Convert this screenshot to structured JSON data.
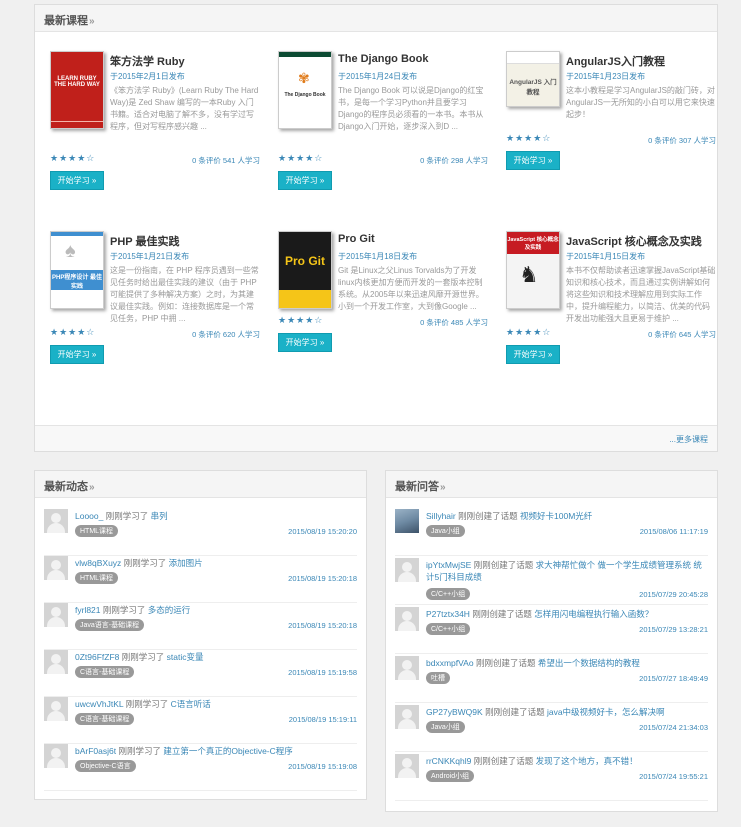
{
  "latest_courses": {
    "heading": "最新课程",
    "more": "...更多课程",
    "courses": [
      {
        "title": "笨方法学 Ruby",
        "date": "于2015年2月1日发布",
        "desc": "《笨方法学 Ruby》(Learn Ruby The Hard Way)是 Zed Shaw 编写的一本Ruby 入门书籍。适合对电脑了解不多，没有学过写程序，但对写程序感兴趣 ...",
        "stars": "★★★★☆",
        "meta": "0 条评价 541 人学习",
        "button": "开始学习 »",
        "cover_text": "LEARN RUBY THE HARD WAY",
        "cover_color": "#c0201b"
      },
      {
        "title": "The Django Book",
        "date": "于2015年1月24日发布",
        "desc": "The Django Book 可以说是Django的红宝书，是每一个学习Python并且要学习Django的程序员必须看的一本书。本书从Django入门开始，逐步深入到D ...",
        "stars": "★★★★☆",
        "meta": "0 条评价 298 人学习",
        "button": "开始学习 »",
        "cover_text": "The Django Book",
        "cover_color": "#ffffff"
      },
      {
        "title": "AngularJS入门教程",
        "date": "于2015年1月23日发布",
        "desc": "这本小教程是学习AngularJS的敲门砖，对AngularJS一无所知的小白可以用它来快速起步！",
        "stars": "★★★★☆",
        "meta": "0 条评价 307 人学习",
        "button": "开始学习 »",
        "cover_text": "AngularJS 入门教程",
        "cover_color": "#f3f1e6"
      },
      {
        "title": "PHP 最佳实践",
        "date": "于2015年1月21日发布",
        "desc": "这是一份指南，在 PHP 程序员遇到一些常见任务时给出最佳实践的建议（由于 PHP 可能提供了多种解决方案）之时，为其建议最佳实践。例如：连接数据库是一个常见任务，PHP 中拥 ...",
        "stars": "★★★★☆",
        "meta": "0 条评价 620 人学习",
        "button": "开始学习 »",
        "cover_text": "PHP程序设计 最佳实践",
        "cover_color": "#3f8fd0"
      },
      {
        "title": "Pro Git",
        "date": "于2015年1月18日发布",
        "desc": "Git 是Linux之父Linus Torvalds为了开发linux内核更加方便而开发的一套版本控制系统。从2005年以来迅速风靡开源世界。小到一个开发工作室，大到像Google ...",
        "stars": "★★★★☆",
        "meta": "0 条评价 485 人学习",
        "button": "开始学习 »",
        "cover_text": "Pro Git",
        "cover_color": "#1a1a1a"
      },
      {
        "title": "JavaScript 核心概念及实践",
        "date": "于2015年1月15日发布",
        "desc": "本书不仅帮助读者迅速掌握JavaScript基础知识和核心技术，而且通过实例讲解如何将这些知识和技术理解应用到实际工作中，提升编程能力，以简洁、优美的代码开发出功能强大且更易于维护 ...",
        "stars": "★★★★☆",
        "meta": "0 条评价 645 人学习",
        "button": "开始学习 »",
        "cover_text": "JavaScript 核心概念及实践",
        "cover_color": "#f4f4f4"
      }
    ]
  },
  "latest_activity": {
    "heading": "最新动态",
    "items": [
      {
        "user": "Loooo_",
        "verb": "刚刚学习了",
        "target": "串列",
        "tag": "HTML课程",
        "time": "2015/08/19 15:20:20"
      },
      {
        "user": "vlw8qBXuyz",
        "verb": "刚刚学习了",
        "target": "添加图片",
        "tag": "HTML课程",
        "time": "2015/08/19 15:20:18"
      },
      {
        "user": "fyrl821",
        "verb": "刚刚学习了",
        "target": "多态的运行",
        "tag": "Java语言-基础课程",
        "time": "2015/08/19 15:20:18"
      },
      {
        "user": "0Zt96FfZF8",
        "verb": "刚刚学习了",
        "target": "static变量",
        "tag": "C语言-基础课程",
        "time": "2015/08/19 15:19:58"
      },
      {
        "user": "uwcwVhJtKL",
        "verb": "刚刚学习了",
        "target": "C语言听话",
        "tag": "C语言-基础课程",
        "time": "2015/08/19 15:19:11"
      },
      {
        "user": "bArF0asj6t",
        "verb": "刚刚学习了",
        "target": "建立第一个真正的Objective-C程序",
        "tag": "Objective-C语言",
        "time": "2015/08/19 15:19:08"
      }
    ]
  },
  "latest_questions": {
    "heading": "最新问答",
    "items": [
      {
        "user": "Sillyhair",
        "verb": "刚刚创建了话题",
        "target": "视频好卡100M光纤",
        "tag": "Java小组",
        "time": "2015/08/06 11:17:19"
      },
      {
        "user": "ipYtxMwjSE",
        "verb": "刚刚创建了话题",
        "target": "求大神帮忙做个 做一个学生成绩管理系统 统计5门科目成绩",
        "tag": "C/C++小组",
        "time": "2015/07/29 20:45:28"
      },
      {
        "user": "P27tztx34H",
        "verb": "刚刚创建了话题",
        "target": "怎样用闪电编程执行输入函数？",
        "tag": "C/C++小组",
        "time": "2015/07/29 13:28:21"
      },
      {
        "user": "bdxxmpfVAo",
        "verb": "刚刚创建了话题",
        "target": "希望出一个数据结构的教程",
        "tag": "吐槽",
        "time": "2015/07/27 18:49:49"
      },
      {
        "user": "GP27yBWQ9K",
        "verb": "刚刚创建了话题",
        "target": "java中级视频好卡，怎么解决啊",
        "tag": "Java小组",
        "time": "2015/07/24 21:34:03"
      },
      {
        "user": "rrCNKKqhl9",
        "verb": "刚刚创建了话题",
        "target": "发现了这个地方，真不错！",
        "tag": "Android小组",
        "time": "2015/07/24 19:55:21"
      }
    ]
  }
}
